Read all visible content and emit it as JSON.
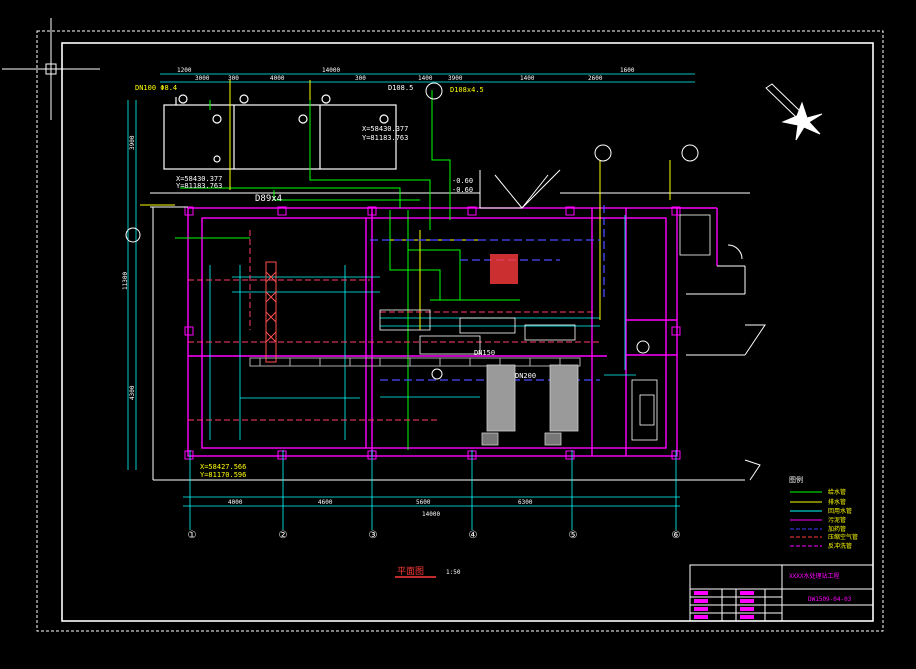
{
  "drawing": {
    "colors": {
      "background": "#000000",
      "frame": "#ffffff",
      "wall": "#ff00ff",
      "dim": "#00ffff",
      "water": "#00ff00",
      "yellow": "#ffff00",
      "red": "#ff0000",
      "gray": "#9a9a9a",
      "blue": "#3b3bff"
    },
    "top_dims": [
      "1200",
      "3000",
      "300",
      "4000",
      "300",
      "1400",
      "3900",
      "1400",
      "2600",
      "1600"
    ],
    "top_total": "14000",
    "bottom_dims": [
      "4000",
      "4600",
      "5600",
      "6300"
    ],
    "bottom_total": "14000",
    "left_dims": [
      "3900",
      "11300",
      "4300"
    ],
    "axis_labels": [
      "①",
      "②",
      "③",
      "④",
      "⑤",
      "⑥"
    ],
    "pipe_labels": {
      "d108_left": "DN100 Φ8.4",
      "d108_mid": "D108.5",
      "d89": "D89x4",
      "top_right": "D108x4.5",
      "coord_a": "X=58430.377",
      "coord_b": "Y=81183.763",
      "coord_c": "X=58427.566",
      "coord_d": "Y=81170.596",
      "elev_a": "-0.60",
      "elev_b": "-0.60",
      "dn150": "DN150",
      "dn200": "DN200"
    },
    "title_block": {
      "project": "XXXX水处理站工程",
      "drawing_no": "DW1509-04-03",
      "plan_title": "平面图",
      "plan_scale": "1:50"
    },
    "legend": {
      "title": "图例",
      "rows": [
        "给水管",
        "排水管",
        "回用水管",
        "污泥管",
        "加药管",
        "压缩空气管",
        "反冲洗管"
      ]
    }
  }
}
